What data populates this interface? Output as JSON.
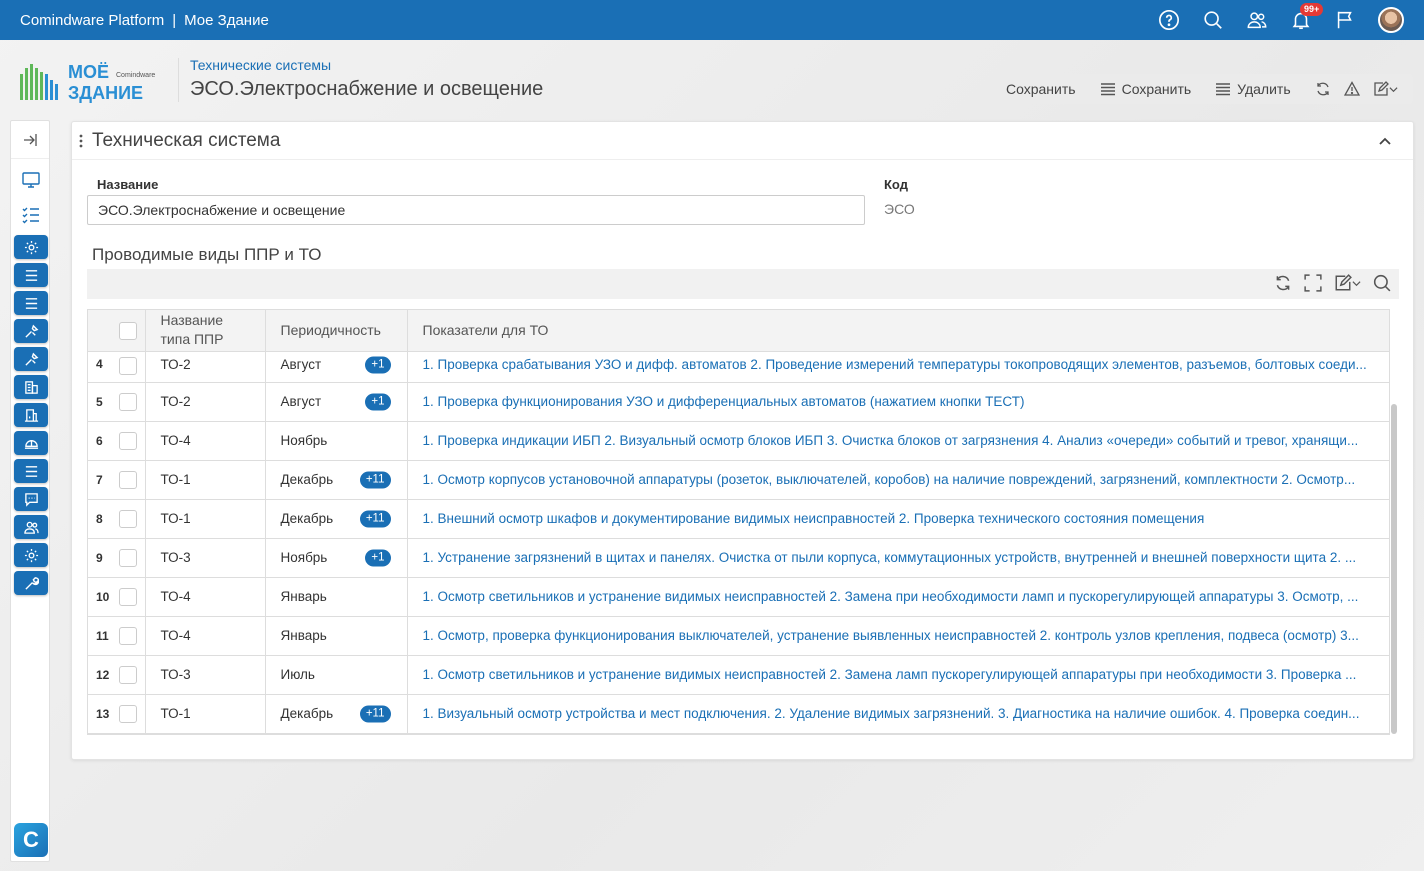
{
  "topbar": {
    "product": "Comindware Platform",
    "separator": "|",
    "app": "Мое Здание",
    "notification_count": "99+"
  },
  "logo": {
    "line1": "МОЁ",
    "line2": "ЗДАНИЕ",
    "brand": "Comindware"
  },
  "header": {
    "breadcrumb": "Технические системы",
    "title": "ЭСО.Электроснабжение и освещение"
  },
  "toolbar": {
    "save1_label": "Сохранить",
    "save2_label": "Сохранить",
    "delete_label": "Удалить"
  },
  "panel": {
    "title": "Техническая система",
    "name_label": "Название",
    "name_value": "ЭСО.Электроснабжение и освещение",
    "code_label": "Код",
    "code_value": "ЭСО",
    "subtable_title": "Проводимые виды ППР и ТО"
  },
  "table": {
    "columns": [
      "Название типа ППР",
      "Периодичность",
      "Показатели для ТО"
    ],
    "rows": [
      {
        "n": "4",
        "type": "ТО-2",
        "period": "Август",
        "badge": "+1",
        "indicators": "1. Проверка срабатывания УЗО и дифф. автоматов 2. Проведение измерений температуры токопроводящих элементов, разъемов, болтовых соеди..."
      },
      {
        "n": "5",
        "type": "ТО-2",
        "period": "Август",
        "badge": "+1",
        "indicators": "1. Проверка функционирования УЗО и дифференциальных автоматов (нажатием кнопки ТЕСТ)"
      },
      {
        "n": "6",
        "type": "ТО-4",
        "period": "Ноябрь",
        "badge": "",
        "indicators": "1. Проверка индикации ИБП 2. Визуальный осмотр блоков ИБП 3. Очистка блоков от загрязнения 4. Анализ «очереди» событий и тревог, хранящи..."
      },
      {
        "n": "7",
        "type": "ТО-1",
        "period": "Декабрь",
        "badge": "+11",
        "indicators": "1. Осмотр корпусов установочной аппаратуры (розеток, выключателей, коробов) на наличие повреждений, загрязнений, комплектности 2. Осмотр..."
      },
      {
        "n": "8",
        "type": "ТО-1",
        "period": "Декабрь",
        "badge": "+11",
        "indicators": "1. Внешний осмотр шкафов и документирование видимых неисправностей 2. Проверка технического состояния помещения"
      },
      {
        "n": "9",
        "type": "ТО-3",
        "period": "Ноябрь",
        "badge": "+1",
        "indicators": "1. Устранение загрязнений в щитах и панелях. Очистка от пыли корпуса, коммутационных устройств, внутренней и внешней поверхности щита 2. ..."
      },
      {
        "n": "10",
        "type": "ТО-4",
        "period": "Январь",
        "badge": "",
        "indicators": "1. Осмотр светильников и устранение видимых неисправностей 2. Замена при необходимости ламп и пускорегулирующей аппаратуры 3. Осмотр, ..."
      },
      {
        "n": "11",
        "type": "ТО-4",
        "period": "Январь",
        "badge": "",
        "indicators": "1. Осмотр, проверка функционирования выключателей, устранение выявленных неисправностей 2. контроль узлов крепления, подвеса (осмотр) 3..."
      },
      {
        "n": "12",
        "type": "ТО-3",
        "period": "Июль",
        "badge": "",
        "indicators": "1. Осмотр светильников и устранение видимых неисправностей 2. Замена ламп пускорегулирующей аппаратуры при необходимости 3. Проверка ..."
      },
      {
        "n": "13",
        "type": "ТО-1",
        "period": "Декабрь",
        "badge": "+11",
        "indicators": "1. Визуальный осмотр устройства и мест подключения. 2. Удаление видимых загрязнений. 3. Диагностика на наличие ошибок. 4. Проверка соедин..."
      }
    ]
  },
  "sidebar": {
    "icons": [
      "collapse-icon",
      "monitor-icon",
      "checklist-icon",
      "gear-icon",
      "list-icon",
      "list-icon",
      "tools-icon",
      "tools-icon",
      "building-icon",
      "building-door-icon",
      "helmet-icon",
      "list-icon",
      "chat-icon",
      "users-icon",
      "gear-icon",
      "wrench-icon"
    ]
  },
  "colors": {
    "accent": "#1a6fb5",
    "badge_red": "#e53935"
  }
}
